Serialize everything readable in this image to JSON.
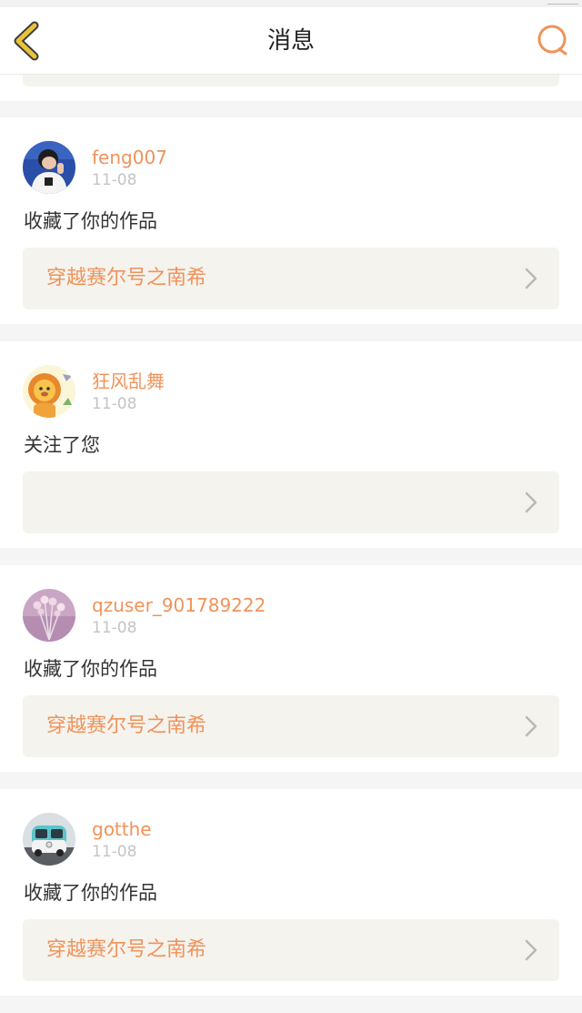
{
  "header": {
    "title": "消息"
  },
  "colors": {
    "accent": "#f0935a",
    "card_link_bg": "#f5f3ee",
    "back_icon": "#e8c23b",
    "search_icon": "#f0935a"
  },
  "notifications": [
    {
      "username": "feng007",
      "date": "11-08",
      "action": "收藏了你的作品",
      "work_title": "穿越赛尔号之南希",
      "avatar_icon": "avatar-boy-icon"
    },
    {
      "username": "狂风乱舞",
      "date": "11-08",
      "action": "关注了您",
      "work_title": "",
      "avatar_icon": "avatar-lion-icon"
    },
    {
      "username": "qzuser_901789222",
      "date": "11-08",
      "action": "收藏了你的作品",
      "work_title": "穿越赛尔号之南希",
      "avatar_icon": "avatar-flowers-icon"
    },
    {
      "username": "gotthe",
      "date": "11-08",
      "action": "收藏了你的作品",
      "work_title": "穿越赛尔号之南希",
      "avatar_icon": "avatar-van-icon"
    }
  ]
}
